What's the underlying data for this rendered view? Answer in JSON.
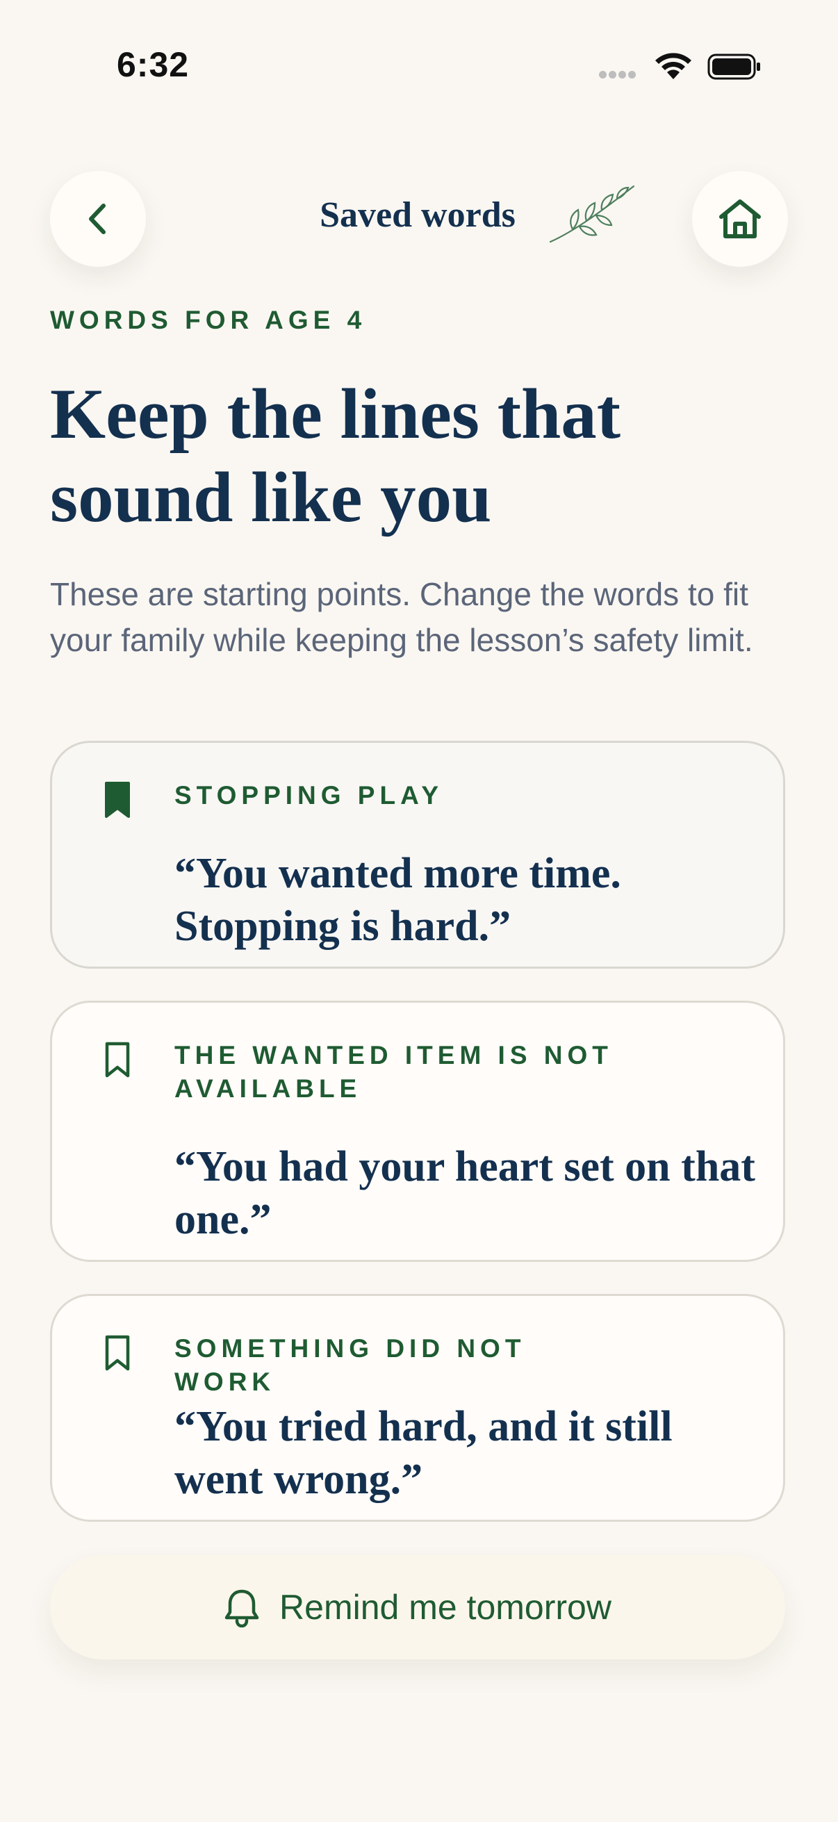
{
  "status": {
    "time": "6:32"
  },
  "header": {
    "title": "Saved words",
    "back_icon": "chevron-left-icon",
    "home_icon": "home-icon",
    "decoration_icon": "leaf-sprig-icon"
  },
  "eyebrow": "WORDS FOR AGE 4",
  "headline": "Keep the lines that sound like you",
  "intro": "These are starting points. Change the words to fit your family while keeping the lesson’s safety limit.",
  "cards": [
    {
      "category": "STOPPING PLAY",
      "quote": "“You wanted more time. Stopping is hard.”",
      "bookmarked": true
    },
    {
      "category": "THE WANTED ITEM IS NOT AVAILABLE",
      "quote": "“You had your heart set on that one.”",
      "bookmarked": false
    },
    {
      "category": "SOMETHING DID NOT WORK",
      "quote": "“You tried hard, and it still went wrong.”",
      "bookmarked": false
    }
  ],
  "remind": {
    "label": "Remind me tomorrow",
    "icon": "bell-icon"
  },
  "colors": {
    "background": "#FAF7F2",
    "navy": "#14304F",
    "green": "#1F5B32",
    "muted": "#5B6579"
  }
}
